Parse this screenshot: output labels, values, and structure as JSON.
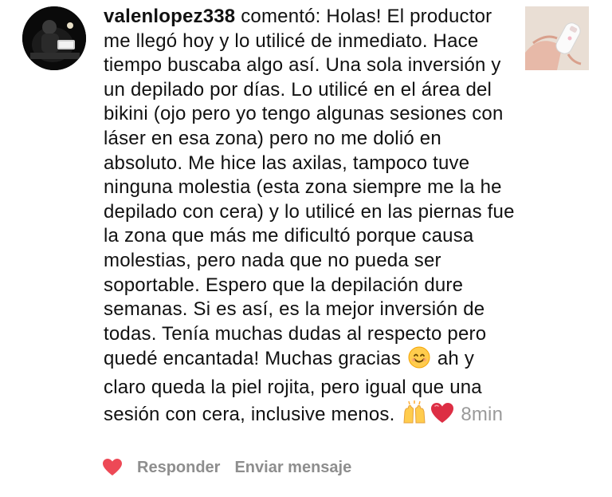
{
  "comment": {
    "username": "valenlopez338",
    "text_before_emoji_1": " comentó: Holas! El productor me llegó hoy y lo utilicé de inmediato. Hace tiempo buscaba algo así. Una sola inversión y un depilado por días. Lo utilicé en el área del bikini (ojo pero yo tengo algunas sesiones con láser en esa zona) pero no me dolió en absoluto. Me hice las axilas, tampoco tuve ninguna molestia (esta zona siempre me la he depilado con cera) y lo utilicé en las piernas fue la zona que más me dificultó porque causa molestias, pero nada que no pueda ser soportable. Espero que la depilación dure semanas. Si es así, es la mejor inversión de todas. Tenía muchas dudas al respecto pero quedé encantada! Muchas gracias ",
    "text_after_emoji_1": " ah y claro queda la piel rojita, pero igual que una sesión con cera, inclusive menos. ",
    "emoji_1": "smiling-face-icon",
    "emoji_2": "raising-hands-icon",
    "emoji_3": "red-heart-icon",
    "timestamp": "8min"
  },
  "actions": {
    "like_icon": "heart-icon",
    "like_color": "#ed4956",
    "reply_label": "Responder",
    "send_message_label": "Enviar mensaje"
  },
  "colors": {
    "text": "#111111",
    "muted": "#8e8e8e",
    "timestamp": "#9a9a9a"
  }
}
